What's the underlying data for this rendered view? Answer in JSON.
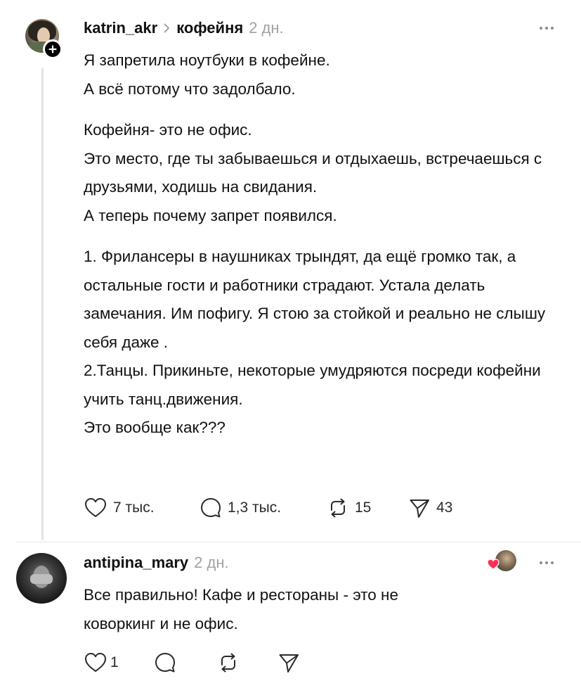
{
  "post": {
    "username": "katrin_akr",
    "community": "кофейня",
    "time": "2 дн.",
    "paragraphs": [
      [
        "Я запретила ноутбуки в кофейне.",
        "А  всё потому что задолбало."
      ],
      [
        "Кофейня- это не офис.",
        "Это место, где ты забываешься и отдыхаешь, встречаешься с друзьями, ходишь на свидания.",
        "А теперь  почему запрет появился."
      ],
      [
        "1. Фрилансеры в наушниках трындят, да ещё громко так, а остальные гости и работники страдают. Устала делать замечания. Им пофигу. Я стою за стойкой и реально не слышу себя даже .",
        "2.Танцы. Прикиньте, некоторые умудряются посреди кофейни учить танц.движения.",
        "Это вообще как???"
      ]
    ],
    "actions": {
      "likes": "7 тыс.",
      "comments": "1,3 тыс.",
      "reposts": "15",
      "shares": "43"
    },
    "icons": {
      "follow": "plus-icon",
      "more": "more-icon",
      "like": "heart-icon",
      "comment": "comment-icon",
      "repost": "repost-icon",
      "share": "send-icon",
      "breadcrumb": "chevron-right-icon"
    }
  },
  "reply": {
    "username": "antipina_mary",
    "time": "2 дн.",
    "text": [
      "Все правильно! Кафе и рестораны - это не",
      "коворкинг и не офис."
    ],
    "actions": {
      "likes": "1"
    },
    "liked_by_author": true
  },
  "colors": {
    "text": "#111111",
    "muted": "#a1a1a1",
    "liked_heart": "#ff2d55",
    "thread_line": "#e4e4e4"
  }
}
